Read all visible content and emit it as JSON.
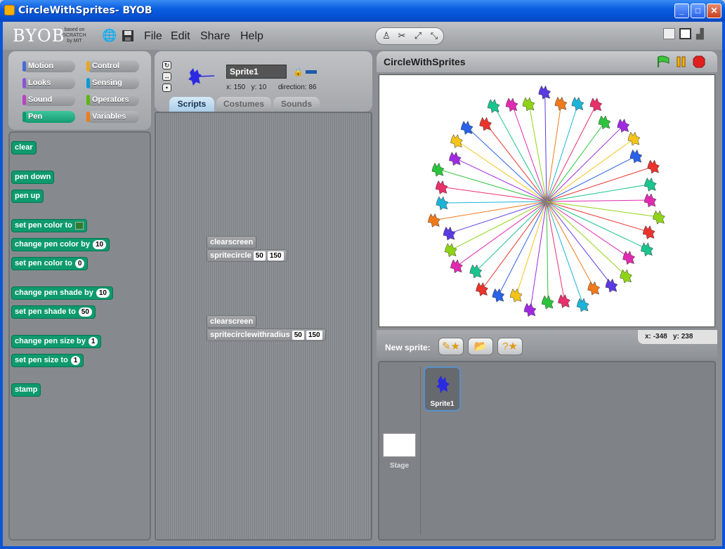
{
  "window": {
    "title": "CircleWithSprites- BYOB",
    "minimize": "_",
    "maximize": "□",
    "close": "✕"
  },
  "logo": {
    "name": "BYOB",
    "sub": "based on SCRATCH by MIT"
  },
  "menu": {
    "file": "File",
    "edit": "Edit",
    "share": "Share",
    "help": "Help"
  },
  "categories": {
    "motion": "Motion",
    "control": "Control",
    "looks": "Looks",
    "sensing": "Sensing",
    "sound": "Sound",
    "operators": "Operators",
    "pen": "Pen",
    "variables": "Variables"
  },
  "category_colors": {
    "motion": "#4a6cd4",
    "control": "#e6a822",
    "looks": "#8a55d7",
    "sensing": "#0c9ad3",
    "sound": "#bb42c3",
    "operators": "#5cb712",
    "pen": "#0e9a6c",
    "variables": "#ee7d16"
  },
  "palette": {
    "clear": "clear",
    "pen_down": "pen down",
    "pen_up": "pen up",
    "set_pen_color_to": "set pen color to",
    "change_pen_color_by": "change pen color by",
    "change_pen_color_value": "10",
    "set_pen_color_to_num": "set pen color to",
    "set_pen_color_value": "0",
    "change_pen_shade_by": "change pen shade by",
    "change_pen_shade_value": "10",
    "set_pen_shade_to": "set pen shade to",
    "set_pen_shade_value": "50",
    "change_pen_size_by": "change pen size by",
    "change_pen_size_value": "1",
    "set_pen_size_to": "set pen size to",
    "set_pen_size_value": "1",
    "stamp": "stamp"
  },
  "sprite_info": {
    "name": "Sprite1",
    "x_label": "x:",
    "x": "150",
    "y_label": "y:",
    "y": "10",
    "direction_label": "direction:",
    "direction": "86"
  },
  "tabs": {
    "scripts": "Scripts",
    "costumes": "Costumes",
    "sounds": "Sounds"
  },
  "scripts": {
    "s1_clear": "clearscreen",
    "s1_call": "spritecircle",
    "s1_a": "50",
    "s1_b": "150",
    "s2_clear": "clearscreen",
    "s2_call": "spritecirclewithradius",
    "s2_a": "50",
    "s2_b": "150"
  },
  "stage": {
    "title": "CircleWithSprites",
    "mouse_x_label": "x:",
    "mouse_x": "-348",
    "mouse_y_label": "y:",
    "mouse_y": "238"
  },
  "new_sprite": {
    "label": "New sprite:"
  },
  "corral": {
    "stage_label": "Stage",
    "sprite_label": "Sprite1"
  },
  "sprite_colors": [
    "#e8342c",
    "#f07a1a",
    "#f4c419",
    "#8fd414",
    "#2cc43c",
    "#19c48e",
    "#1bb4d8",
    "#2a62e8",
    "#5a3ae0",
    "#a02ae0",
    "#e02ab0",
    "#e8306a"
  ]
}
